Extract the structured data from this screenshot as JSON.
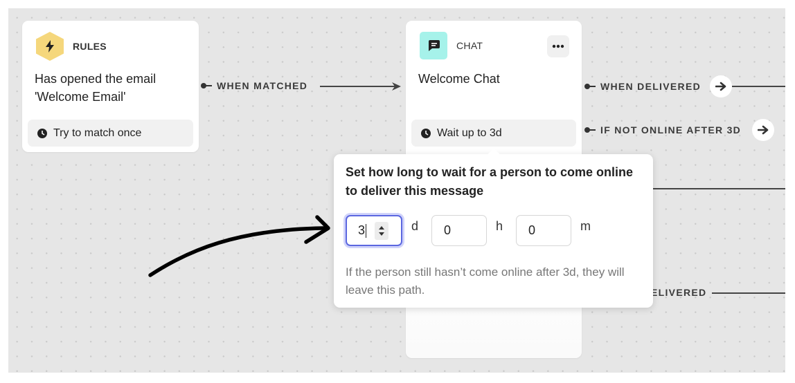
{
  "canvas": {
    "background_color": "#e6e6e6"
  },
  "rules_card": {
    "kind_label": "RULES",
    "icon": "lightning-bolt-icon",
    "icon_bg_color": "#f5d77c",
    "title_line1": "Has opened the email",
    "title_line2": "'Welcome Email'",
    "footer": "Try to match once"
  },
  "chat_card": {
    "kind_label": "CHAT",
    "icon": "chat-bubble-icon",
    "icon_bg_color": "#a6f2ea",
    "title": "Welcome Chat",
    "more_button": "more-options-icon",
    "footer": "Wait up to 3d"
  },
  "edges": {
    "when_matched": "WHEN MATCHED",
    "when_delivered": "WHEN DELIVERED",
    "if_not_online": "IF NOT ONLINE AFTER 3D",
    "partial_delivered": "ELIVERED"
  },
  "popover": {
    "title": "Set how long to wait for a person to come online to deliver this message",
    "days": {
      "value": "3",
      "unit": "d"
    },
    "hours": {
      "value": "0",
      "unit": "h"
    },
    "minutes": {
      "value": "0",
      "unit": "m"
    },
    "help_text": "If the person still hasn’t come online after 3d, they will leave this path.",
    "focus_color": "#5b67e0"
  }
}
